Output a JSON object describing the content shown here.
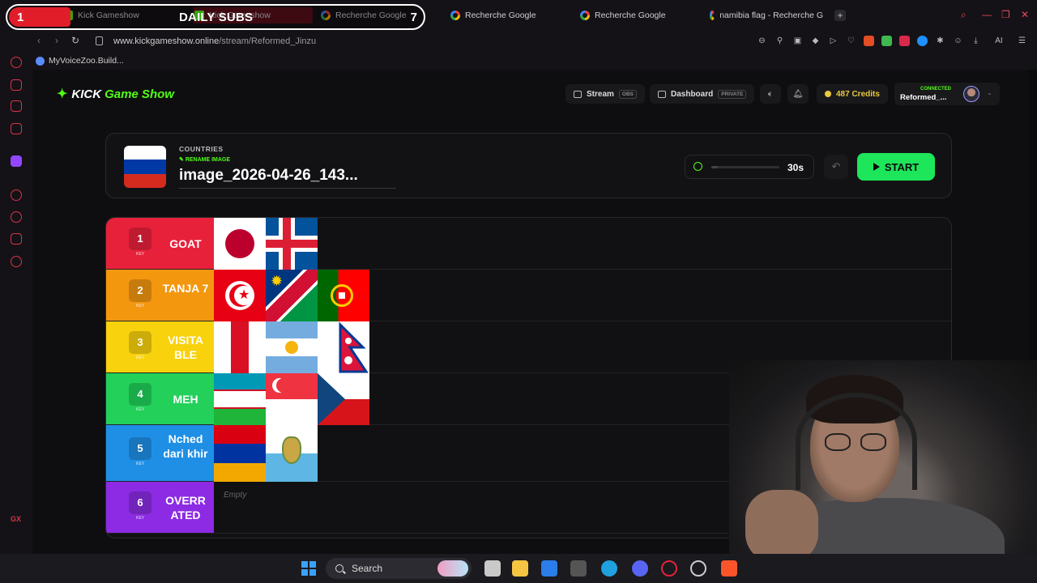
{
  "overlay": {
    "start": "1",
    "title": "DAILY SUBS",
    "end": "7"
  },
  "tabs": [
    {
      "label": "Kick Gameshow"
    },
    {
      "label": "Kick Gameshow"
    },
    {
      "label": "Recherche Google"
    },
    {
      "label": "Recherche Google"
    },
    {
      "label": "Recherche Google"
    },
    {
      "label": "namibia flag - Recherche G"
    }
  ],
  "url": {
    "host": "www.kickgameshow.online",
    "path": "/stream/Reformed_Jinzu"
  },
  "bookmarks": [
    {
      "label": "MyVoiceZoo.Build..."
    }
  ],
  "app": {
    "logo_kick": "KICK",
    "logo_game": "Game Show",
    "stream_label": "Stream",
    "stream_pill": "OBS",
    "dashboard_label": "Dashboard",
    "dashboard_pill": "PRIVATE",
    "credits": "487 Credits",
    "connected": "CONNECTED",
    "username": "Reformed_..."
  },
  "panel": {
    "category": "COUNTRIES",
    "rename": "RENAME IMAGE",
    "image_name": "image_2026-04-26_143...",
    "timer": "30s",
    "timer_fill": 0.1,
    "start": "START"
  },
  "tiers": [
    {
      "key": "1",
      "key_sub": "KEY",
      "name": "GOAT",
      "color": "#e8213b",
      "flags": [
        "japan",
        "iceland"
      ]
    },
    {
      "key": "2",
      "key_sub": "KEY",
      "name": "TANJA 7",
      "color": "#f3970f",
      "flags": [
        "tunisia",
        "namibia",
        "portugal"
      ]
    },
    {
      "key": "3",
      "key_sub": "KEY",
      "name": "VISITA BLE",
      "color": "#f8d20d",
      "flags": [
        "peru",
        "argentina",
        "nepal"
      ]
    },
    {
      "key": "4",
      "key_sub": "KEY",
      "name": "MEH",
      "color": "#22d05a",
      "flags": [
        "uzbekistan",
        "singapore",
        "czechia"
      ]
    },
    {
      "key": "5",
      "key_sub": "KEY",
      "name": "Nched dari khir",
      "color": "#1f8fe6",
      "flags": [
        "armenia",
        "san-marino"
      ]
    },
    {
      "key": "6",
      "key_sub": "KEY",
      "name": "OVERR ATED",
      "color": "#8c2be3",
      "flags": [],
      "empty": "Empty"
    }
  ],
  "taskbar": {
    "search": "Search"
  },
  "colors": {
    "accent": "#53fc18",
    "start_button": "#1ee65a",
    "overlay_red": "#e11d2a"
  }
}
